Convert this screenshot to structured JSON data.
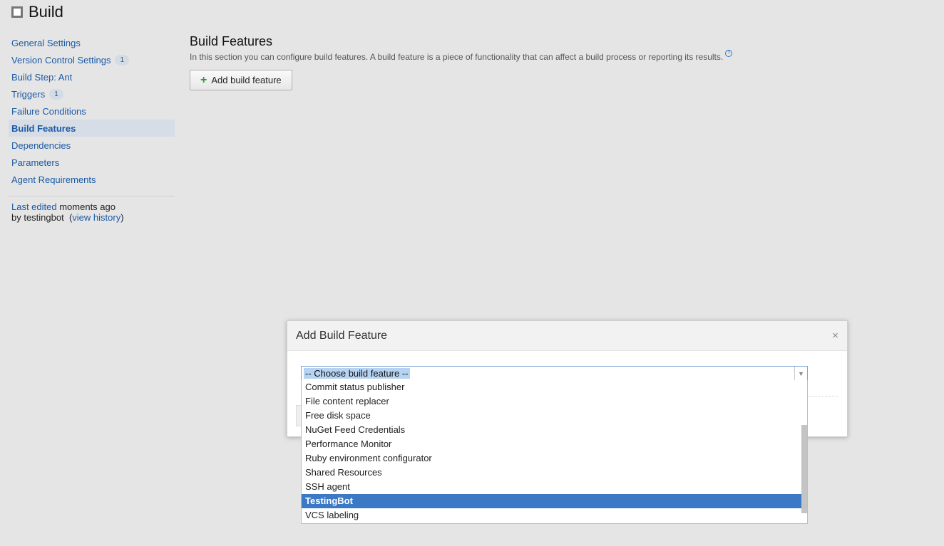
{
  "header": {
    "title": "Build"
  },
  "sidebar": {
    "items": [
      {
        "label": "General Settings",
        "badge": null
      },
      {
        "label": "Version Control Settings",
        "badge": "1"
      },
      {
        "label": "Build Step: Ant",
        "badge": null
      },
      {
        "label": "Triggers",
        "badge": "1"
      },
      {
        "label": "Failure Conditions",
        "badge": null
      },
      {
        "label": "Build Features",
        "badge": null,
        "active": true
      },
      {
        "label": "Dependencies",
        "badge": null
      },
      {
        "label": "Parameters",
        "badge": null
      },
      {
        "label": "Agent Requirements",
        "badge": null
      }
    ],
    "last_edited_link": "Last edited",
    "last_edited_text": " moments ago",
    "by_text": "by testingbot",
    "open_paren": "(",
    "view_history": "view history",
    "close_paren": ")"
  },
  "main": {
    "title": "Build Features",
    "description": "In this section you can configure build features. A build feature is a piece of functionality that can affect a build process or reporting its results.",
    "help_glyph": "?",
    "add_button_icon": "+",
    "add_button_label": "Add build feature"
  },
  "dialog": {
    "title": "Add Build Feature",
    "close_glyph": "×",
    "select_value": "-- Choose build feature --",
    "arrow_glyph": "▼",
    "options": [
      "Commit status publisher",
      "File content replacer",
      "Free disk space",
      "NuGet Feed Credentials",
      "Performance Monitor",
      "Ruby environment configurator",
      "Shared Resources",
      "SSH agent",
      "TestingBot",
      "VCS labeling"
    ],
    "highlighted_option": "TestingBot"
  },
  "colors": {
    "link": "#1a5aa6",
    "active_nav_bg": "#d6dde6",
    "highlight": "#3b78c6",
    "plus": "#2c9a2c"
  },
  "icons": {
    "build_status": "empty-square-icon",
    "help": "help-circle-icon",
    "add": "plus-icon",
    "close": "close-icon",
    "dropdown": "chevron-down-icon"
  }
}
